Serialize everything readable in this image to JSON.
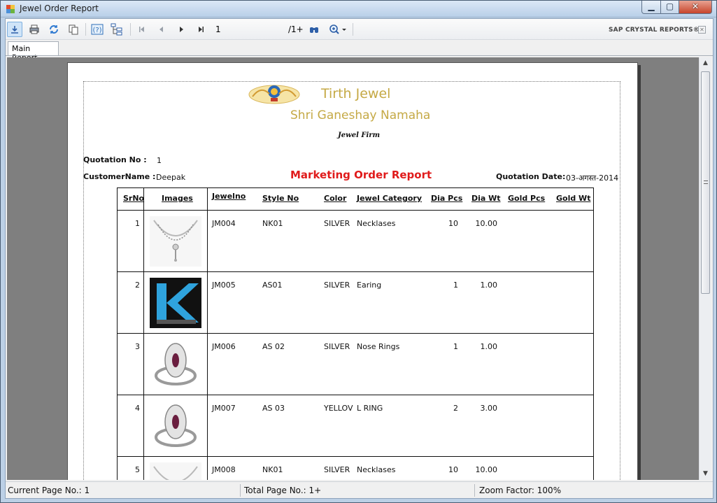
{
  "window": {
    "title": "Jewel Order Report"
  },
  "toolbar": {
    "page_value": "1",
    "page_total": "/1+",
    "brand": "SAP CRYSTAL REPORTS®",
    "icons": [
      "export-icon",
      "print-icon",
      "refresh-icon",
      "copy-icon",
      "help-icon",
      "group-tree-icon",
      "first-page-icon",
      "previous-page-icon",
      "next-page-icon",
      "last-page-icon",
      "find-icon",
      "zoom-icon"
    ]
  },
  "tabs": [
    {
      "label": "Main Report"
    }
  ],
  "report": {
    "company": "Tirth Jewel",
    "subtitle": "Shri Ganeshay Namaha",
    "firm": "Jewel Firm",
    "title": "Marketing Order Report",
    "quotation_no_label": "Quotation No :",
    "quotation_no": "1",
    "customer_name_label": "CustomerName :",
    "customer_name": "Deepak",
    "quotation_date_label": "Quotation Date:",
    "quotation_date": "03-अगस्त-2014",
    "columns": [
      "SrNo",
      "Images",
      "Jewelno",
      "Style No",
      "Color",
      "Jewel Category",
      "Dia Pcs",
      "Dia Wt",
      "Gold Pcs",
      "Gold Wt"
    ],
    "rows": [
      {
        "srno": "1",
        "image": "necklace",
        "jewelno": "JM004",
        "style": "NK01",
        "color": "SILVER",
        "category": "Necklases",
        "dia_pcs": "10",
        "dia_wt": "10.00"
      },
      {
        "srno": "2",
        "image": "k-logo",
        "jewelno": "JM005",
        "style": "AS01",
        "color": "SILVER",
        "category": "Earing",
        "dia_pcs": "1",
        "dia_wt": "1.00"
      },
      {
        "srno": "3",
        "image": "ring",
        "jewelno": "JM006",
        "style": "AS 02",
        "color": "SILVER",
        "category": "Nose Rings",
        "dia_pcs": "1",
        "dia_wt": "1.00"
      },
      {
        "srno": "4",
        "image": "ring",
        "jewelno": "JM007",
        "style": "AS 03",
        "color": "YELLOV",
        "category": "L RING",
        "dia_pcs": "2",
        "dia_wt": "3.00"
      },
      {
        "srno": "5",
        "image": "necklace",
        "jewelno": "JM008",
        "style": "NK01",
        "color": "SILVER",
        "category": "Necklases",
        "dia_pcs": "10",
        "dia_wt": "10.00"
      }
    ]
  },
  "status": {
    "current_page": "Current Page No.: 1",
    "total_page": "Total Page No.: 1+",
    "zoom": "Zoom Factor: 100%"
  },
  "colors": {
    "gold": "#c5a945",
    "title_red": "#e01b1b",
    "viewer_bg": "#7f7f7f"
  }
}
